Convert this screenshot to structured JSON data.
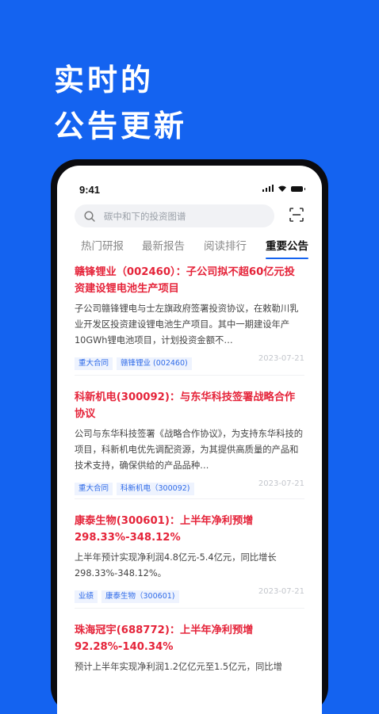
{
  "headline": {
    "line1": "实时的",
    "line2": "公告更新"
  },
  "status_bar": {
    "time": "9:41"
  },
  "search": {
    "placeholder": "碳中和下的投资图谱"
  },
  "tabs": [
    {
      "label": "热门研报"
    },
    {
      "label": "最新报告"
    },
    {
      "label": "阅读排行"
    },
    {
      "label": "重要公告"
    }
  ],
  "announcements": [
    {
      "title": "赣锋锂业（002460）：子公司拟不超60亿元投资建设锂电池生产项目",
      "summary": "子公司赣锋锂电与士左旗政府签署投资协议，在敕勒川乳业开发区投资建设锂电池生产项目。其中一期建设年产10GWh锂电池项目，计划投资金额不…",
      "tags": [
        "重大合同",
        "赣锋锂业 (002460)"
      ],
      "date": "2023-07-21"
    },
    {
      "title": "科新机电(300092)：与东华科技签署战略合作协议",
      "summary": "公司与东华科技签署《战略合作协议》，为支持东华科技的项目，科新机电优先调配资源，为其提供高质量的产品和技术支持，确保供给的产品品种…",
      "tags": [
        "重大合同",
        "科新机电（300092)"
      ],
      "date": "2023-07-21"
    },
    {
      "title": "康泰生物(300601)：上半年净利预增298.33%-348.12%",
      "summary": "上半年预计实现净利润4.8亿元-5.4亿元，同比增长298.33%-348.12%。",
      "tags": [
        "业绩",
        "康泰生物（300601)"
      ],
      "date": "2023-07-21"
    },
    {
      "title": "珠海冠宇(688772)：上半年净利预增92.28%-140.34%",
      "summary": "预计上半年实现净利润1.2亿亿元至1.5亿元，同比增",
      "tags": [],
      "date": ""
    }
  ],
  "colors": {
    "brand_blue": "#1463f0",
    "title_red": "#e5243a",
    "tag_blue": "#2f6be8"
  }
}
